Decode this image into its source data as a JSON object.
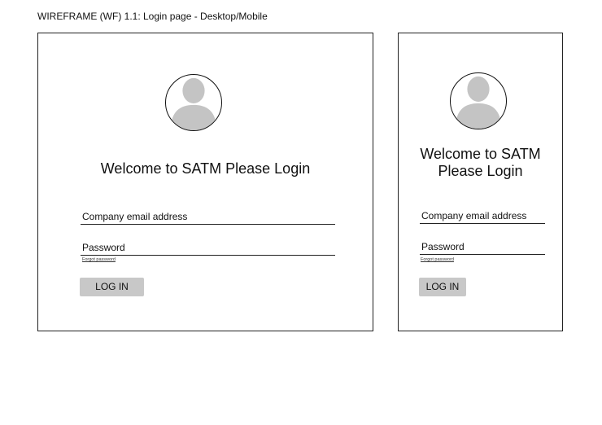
{
  "caption": "WIREFRAME (WF) 1.1: Login page - Desktop/Mobile",
  "desktop": {
    "welcome": "Welcome to SATM Please Login",
    "email_label": "Company email address",
    "password_label": "Password",
    "forgot_link": "Forgot password",
    "login_button": "LOG IN"
  },
  "mobile": {
    "welcome": "Welcome to SATM Please Login",
    "email_label": "Company email address",
    "password_label": "Password",
    "forgot_link": "Forgot password",
    "login_button": "LOG IN"
  },
  "icons": {
    "avatar": "user-avatar-icon"
  },
  "colors": {
    "border": "#222222",
    "placeholder_gray": "#c4c4c4",
    "button_gray": "#c8c8c8"
  }
}
